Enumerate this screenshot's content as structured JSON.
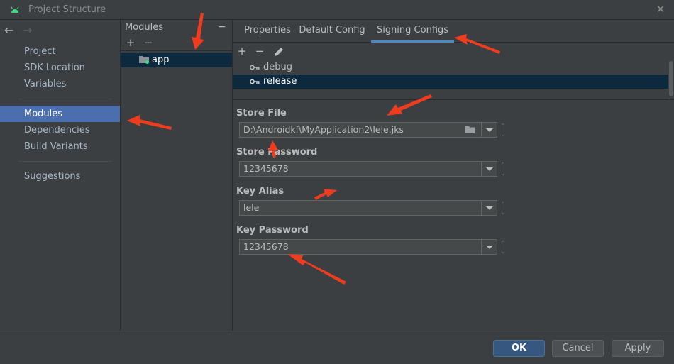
{
  "window": {
    "title": "Project Structure",
    "close_glyph": "✕"
  },
  "nav": {
    "back_glyph": "←",
    "forward_glyph": "→",
    "items": [
      {
        "label": "Project"
      },
      {
        "label": "SDK Location"
      },
      {
        "label": "Variables"
      },
      {
        "label": "Modules",
        "selected": true
      },
      {
        "label": "Dependencies"
      },
      {
        "label": "Build Variants"
      },
      {
        "label": "Suggestions"
      }
    ]
  },
  "modules": {
    "title": "Modules",
    "minus_glyph": "−",
    "add_glyph": "+",
    "remove_glyph": "−",
    "items": [
      {
        "label": "app",
        "selected": true
      }
    ]
  },
  "tabs": [
    {
      "label": "Properties"
    },
    {
      "label": "Default Config"
    },
    {
      "label": "Signing Configs",
      "active": true
    }
  ],
  "signing_toolbar": {
    "add_glyph": "+",
    "remove_glyph": "−"
  },
  "signing_configs": [
    {
      "label": "debug"
    },
    {
      "label": "release",
      "selected": true
    }
  ],
  "form": {
    "store_file": {
      "label": "Store File",
      "value": "D:\\Androidkf\\MyApplication2\\lele.jks"
    },
    "store_password": {
      "label": "Store Password",
      "value": "12345678"
    },
    "key_alias": {
      "label": "Key Alias",
      "value": "lele"
    },
    "key_password": {
      "label": "Key Password",
      "value": "12345678"
    }
  },
  "footer": {
    "ok_label": "OK",
    "cancel_label": "Cancel",
    "apply_label": "Apply"
  },
  "colors": {
    "background": "#3c3f41",
    "selection_blue": "#4b6eaf",
    "row_selection": "#0d293e",
    "tab_accent": "#4a88c7",
    "annotation_red": "#f03c1e",
    "android_green": "#3ddc84"
  }
}
